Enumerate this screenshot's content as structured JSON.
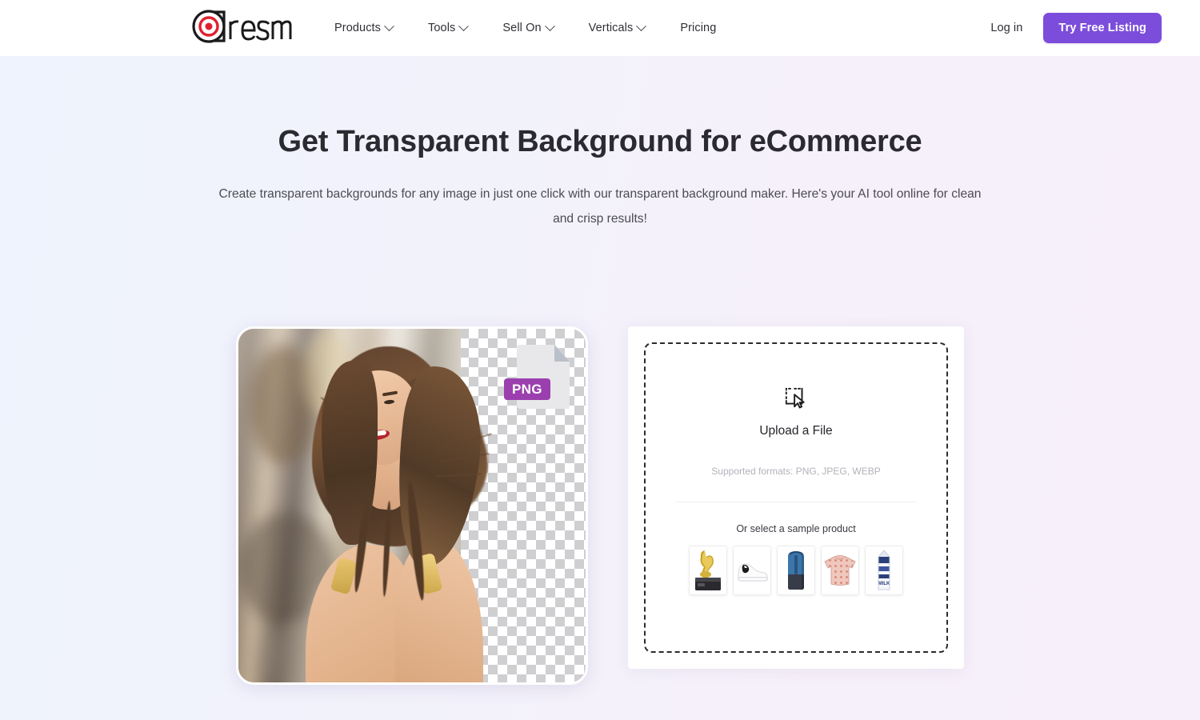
{
  "brand": {
    "name": "Dresma",
    "logo_icon": "dresma-logo-target-icon",
    "accent": "#7c4ddb"
  },
  "nav": {
    "items": [
      {
        "label": "Products",
        "has_dropdown": true,
        "icon": "chevron-down-icon"
      },
      {
        "label": "Tools",
        "has_dropdown": true,
        "icon": "chevron-down-icon"
      },
      {
        "label": "Sell On",
        "has_dropdown": true,
        "icon": "chevron-down-icon"
      },
      {
        "label": "Verticals",
        "has_dropdown": true,
        "icon": "chevron-down-icon"
      },
      {
        "label": "Pricing",
        "has_dropdown": false,
        "icon": ""
      }
    ],
    "login_label": "Log in",
    "cta_label": "Try Free Listing"
  },
  "hero": {
    "title": "Get Transparent Background for eCommerce",
    "subtitle": "Create transparent backgrounds for any image in just one click with our transparent background maker. Here's your AI tool online for clean and crisp results!"
  },
  "preview": {
    "image_alt": "Smiling woman in gold sequin dress with half-removed street background",
    "badge_label": "PNG",
    "badge_color": "#9b3fae",
    "checker_color": "#cfcfd2"
  },
  "upload": {
    "icon": "upload-cursor-select-icon",
    "title": "Upload a File",
    "supported_formats": "Supported formats: PNG, JPEG, WEBP",
    "sample_label": "Or select a sample product",
    "samples": [
      {
        "name": "gold-deer-trophy",
        "alt": "Gold deer statue trophy"
      },
      {
        "name": "white-sneaker",
        "alt": "White leather sneaker"
      },
      {
        "name": "blue-backpack",
        "alt": "Blue and navy backpack"
      },
      {
        "name": "pink-sweater",
        "alt": "Pink patterned sweater"
      },
      {
        "name": "milk-carton",
        "alt": "Blue and white milk carton"
      }
    ]
  }
}
